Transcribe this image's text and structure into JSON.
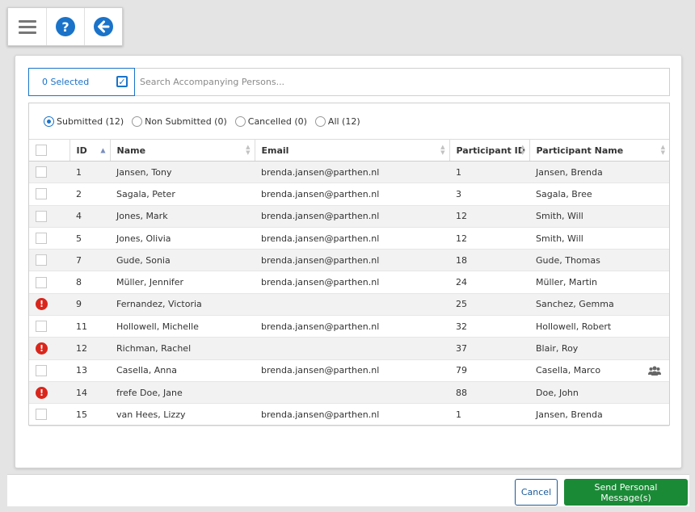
{
  "toolbar": {
    "menu_icon": "hamburger-menu-icon",
    "help_icon": "question-circle-icon",
    "back_icon": "arrow-left-circle-icon",
    "accent": "#1a73c9"
  },
  "search": {
    "selected_label": "0 Selected",
    "placeholder": "Search Accompanying Persons..."
  },
  "filters": [
    {
      "label": "Submitted (12)",
      "checked": true
    },
    {
      "label": "Non Submitted (0)",
      "checked": false
    },
    {
      "label": "Cancelled (0)",
      "checked": false
    },
    {
      "label": "All (12)",
      "checked": false
    }
  ],
  "table": {
    "columns": [
      "ID",
      "Name",
      "Email",
      "Participant ID",
      "Participant Name"
    ],
    "rows": [
      {
        "status": "ok",
        "id": "1",
        "name": "Jansen, Tony",
        "email": "brenda.jansen@parthen.nl",
        "pid": "1",
        "pname": "Jansen, Brenda",
        "group": false
      },
      {
        "status": "ok",
        "id": "2",
        "name": "Sagala, Peter",
        "email": "brenda.jansen@parthen.nl",
        "pid": "3",
        "pname": "Sagala, Bree",
        "group": false
      },
      {
        "status": "ok",
        "id": "4",
        "name": "Jones, Mark",
        "email": "brenda.jansen@parthen.nl",
        "pid": "12",
        "pname": "Smith, Will",
        "group": false
      },
      {
        "status": "ok",
        "id": "5",
        "name": "Jones, Olivia",
        "email": "brenda.jansen@parthen.nl",
        "pid": "12",
        "pname": "Smith, Will",
        "group": false
      },
      {
        "status": "ok",
        "id": "7",
        "name": "Gude, Sonia",
        "email": "brenda.jansen@parthen.nl",
        "pid": "18",
        "pname": "Gude, Thomas",
        "group": false
      },
      {
        "status": "ok",
        "id": "8",
        "name": "Müller, Jennifer",
        "email": "brenda.jansen@parthen.nl",
        "pid": "24",
        "pname": "Müller, Martin",
        "group": false
      },
      {
        "status": "error",
        "id": "9",
        "name": "Fernandez, Victoria",
        "email": "",
        "pid": "25",
        "pname": "Sanchez, Gemma",
        "group": false
      },
      {
        "status": "ok",
        "id": "11",
        "name": "Hollowell, Michelle",
        "email": "brenda.jansen@parthen.nl",
        "pid": "32",
        "pname": "Hollowell, Robert",
        "group": false
      },
      {
        "status": "error",
        "id": "12",
        "name": "Richman, Rachel",
        "email": "",
        "pid": "37",
        "pname": "Blair, Roy",
        "group": false
      },
      {
        "status": "ok",
        "id": "13",
        "name": "Casella, Anna",
        "email": "brenda.jansen@parthen.nl",
        "pid": "79",
        "pname": "Casella, Marco",
        "group": true
      },
      {
        "status": "error",
        "id": "14",
        "name": "frefe Doe, Jane",
        "email": "",
        "pid": "88",
        "pname": "Doe, John",
        "group": false
      },
      {
        "status": "ok",
        "id": "15",
        "name": "van Hees, Lizzy",
        "email": "brenda.jansen@parthen.nl",
        "pid": "1",
        "pname": "Jansen, Brenda",
        "group": false
      }
    ]
  },
  "footer": {
    "cancel_label": "Cancel",
    "send_label": "Send Personal Message(s)",
    "send_color": "#1a8a36"
  }
}
